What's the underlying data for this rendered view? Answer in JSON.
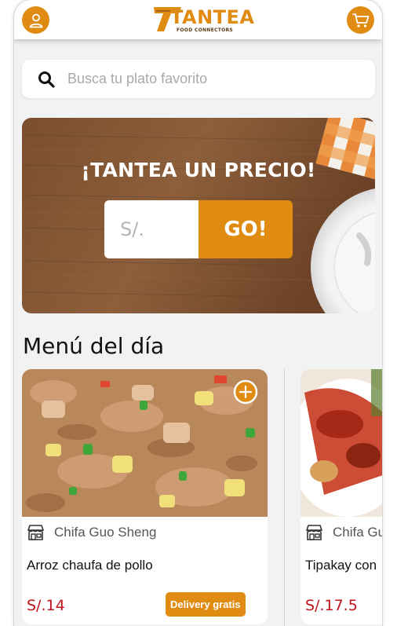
{
  "brand": {
    "name": "TANTEA",
    "tagline": "FOOD CONNECTORS",
    "accent_color": "#e08b12",
    "price_color": "#c0121a"
  },
  "topbar": {
    "left_icon": "user-icon",
    "right_icon": "cart-icon"
  },
  "search": {
    "placeholder": "Busca tu plato favorito",
    "value": "",
    "icon": "search-icon"
  },
  "hero": {
    "title": "¡TANTEA UN PRECIO!",
    "price_placeholder": "S/.",
    "go_label": "GO!"
  },
  "menu": {
    "title": "Menú del día",
    "items": [
      {
        "restaurant": "Chifa Guo Sheng",
        "dish": "Arroz chaufa de pollo",
        "price": "S/.14",
        "badge": "Delivery gratis"
      },
      {
        "restaurant": "Chifa Gu",
        "dish": "Tipakay con",
        "price": "S/.17.5"
      }
    ]
  }
}
